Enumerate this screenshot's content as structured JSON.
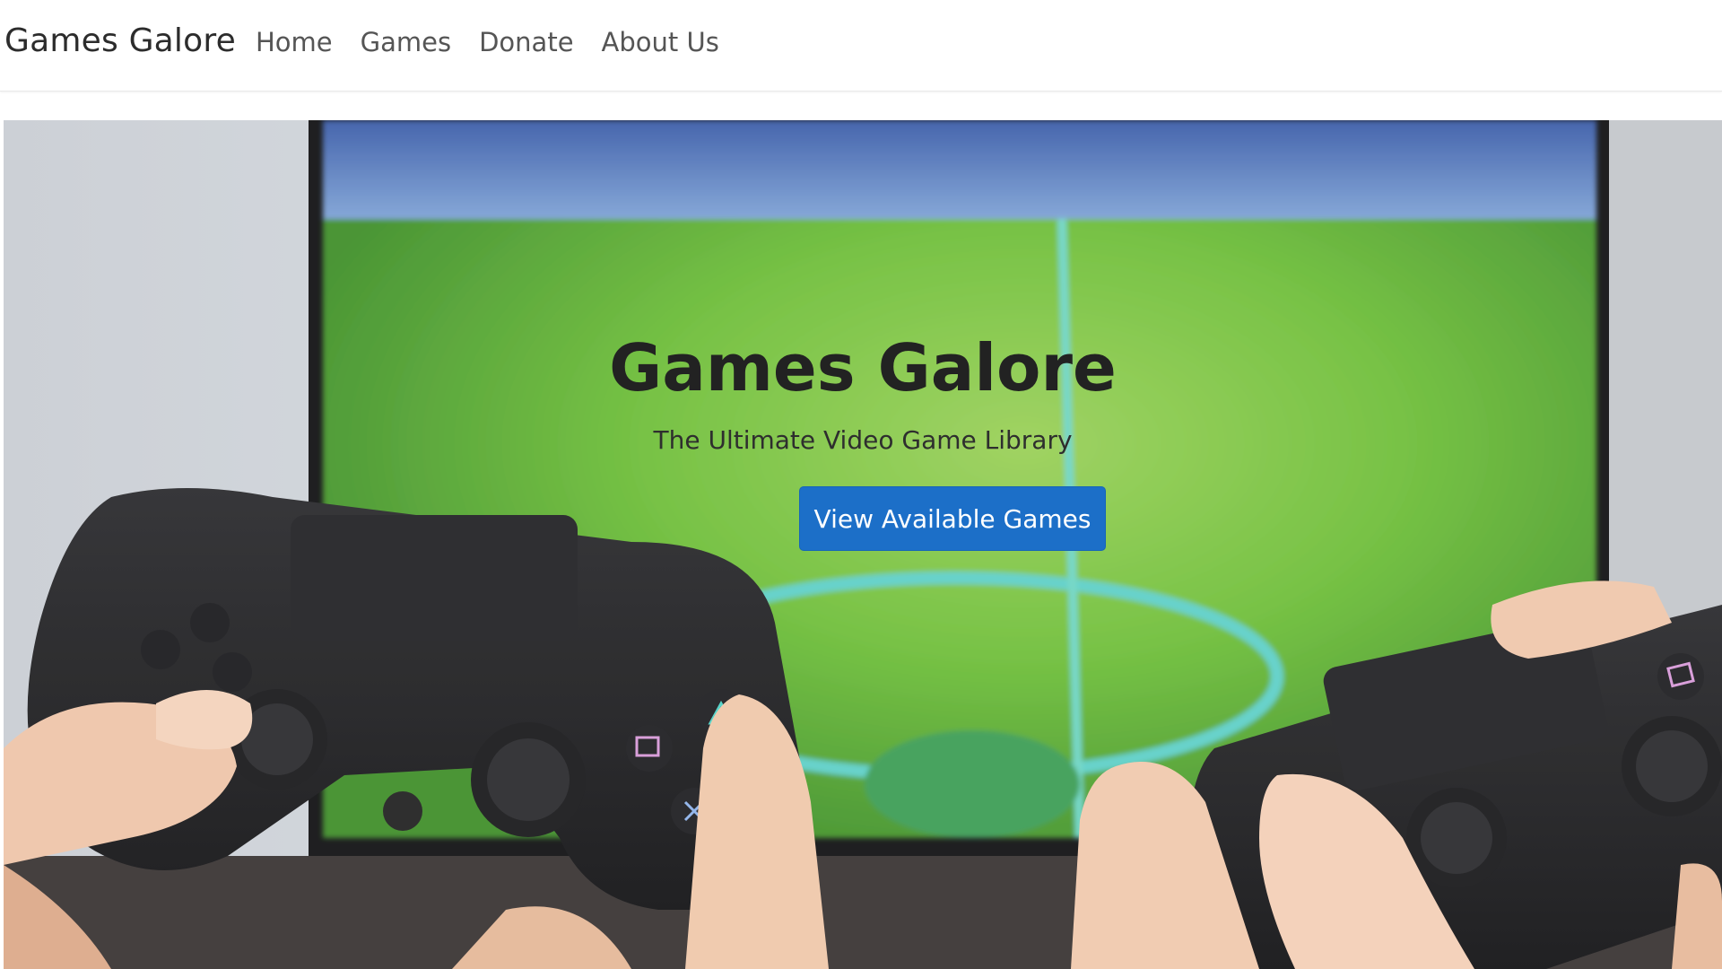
{
  "navbar": {
    "brand": "Games Galore",
    "links": [
      "Home",
      "Games",
      "Donate",
      "About Us"
    ]
  },
  "hero": {
    "title": "Games Galore",
    "subtitle": "The Ultimate Video Game Library",
    "cta_label": "View Available Games",
    "image_description_icon": "gamepad-photo"
  },
  "colors": {
    "button_bg": "#1c6fc8",
    "pitch_green": "#6fbf3a",
    "controller": "#1e1e20"
  }
}
